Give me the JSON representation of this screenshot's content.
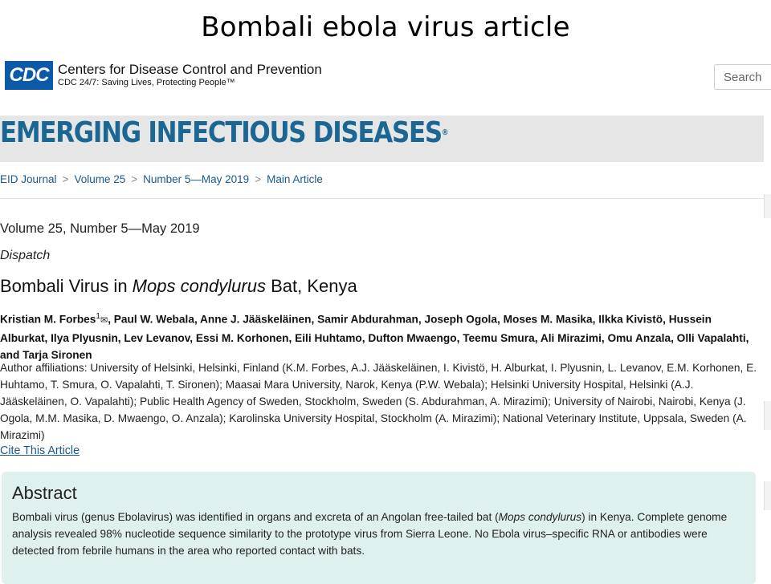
{
  "slide": {
    "title": "Bombali ebola virus article"
  },
  "header": {
    "logo_text": "CDC",
    "org_name": "Centers for Disease Control and Prevention",
    "tagline": "CDC 24/7: Saving Lives, Protecting People™",
    "search_placeholder": "Search"
  },
  "journal": {
    "name": "EMERGING INFECTIOUS DISEASES",
    "trademark": "®"
  },
  "breadcrumb": {
    "items": [
      "EID Journal",
      "Volume 25",
      "Number 5—May 2019",
      "Main Article"
    ],
    "separator": ">"
  },
  "article": {
    "volume": "Volume 25, Number 5—May 2019",
    "type": "Dispatch",
    "title_prefix": "Bombali Virus in ",
    "title_italic": "Mops condylurus",
    "title_suffix": " Bat, Kenya",
    "first_author": "Kristian M. Forbes",
    "first_author_mark": "1",
    "mail_icon": "✉",
    "authors_rest": ", Paul W. Webala, Anne J. Jääskeläinen, Samir Abdurahman, Joseph Ogola, Moses M. Masika, Ilkka Kivistö, Hussein Alburkat, Ilya Plyusnin, Lev Levanov, Essi M. Korhonen, Eili Huhtamo, Dufton Mwaengo, Teemu Smura, Ali Mirazimi, Omu Anzala, Olli Vapalahti, and Tarja Sironen",
    "affiliations": "Author affiliations: University of Helsinki, Helsinki, Finland (K.M. Forbes, A.J. Jääskeläinen, I. Kivistö, H. Alburkat, I. Plyusnin, L. Levanov, E.M. Korhonen, E. Huhtamo, T. Smura, O. Vapalahti, T. Sironen); Maasai Mara University, Narok, Kenya (P.W. Webala); Helsinki University Hospital, Helsinki (A.J. Jääskeläinen, O. Vapalahti); Public Health Agency of Sweden, Stockholm, Sweden (S. Abdurahman, A. Mirazimi); University of Nairobi, Nairobi, Kenya (J. Ogola, M.M. Masika, D. Mwaengo, O. Anzala); Karolinska University Hospital, Stockholm (A. Mirazimi); National Veterinary Institute, Uppsala, Sweden (A. Mirazimi)",
    "cite_link": "Cite This Article"
  },
  "abstract": {
    "heading": "Abstract",
    "text_part1": "Bombali virus (genus Ebolavirus) was identified in organs and excreta of an Angolan free-tailed bat (",
    "text_italic": "Mops condylurus",
    "text_part2": ") in Kenya. Complete genome analysis revealed 98% nucleotide sequence similarity to the prototype virus from Sierra Leone. No Ebola virus–specific RNA or antibodies were detected from febrile humans in the area who reported contact with bats."
  },
  "colors": {
    "cdc_blue": "#0b5aa8",
    "journal_blue": "#1a6794",
    "link_blue": "#1a5a8a",
    "banner_gray": "#e6e6e6",
    "abstract_bg": "#dff1ee"
  }
}
